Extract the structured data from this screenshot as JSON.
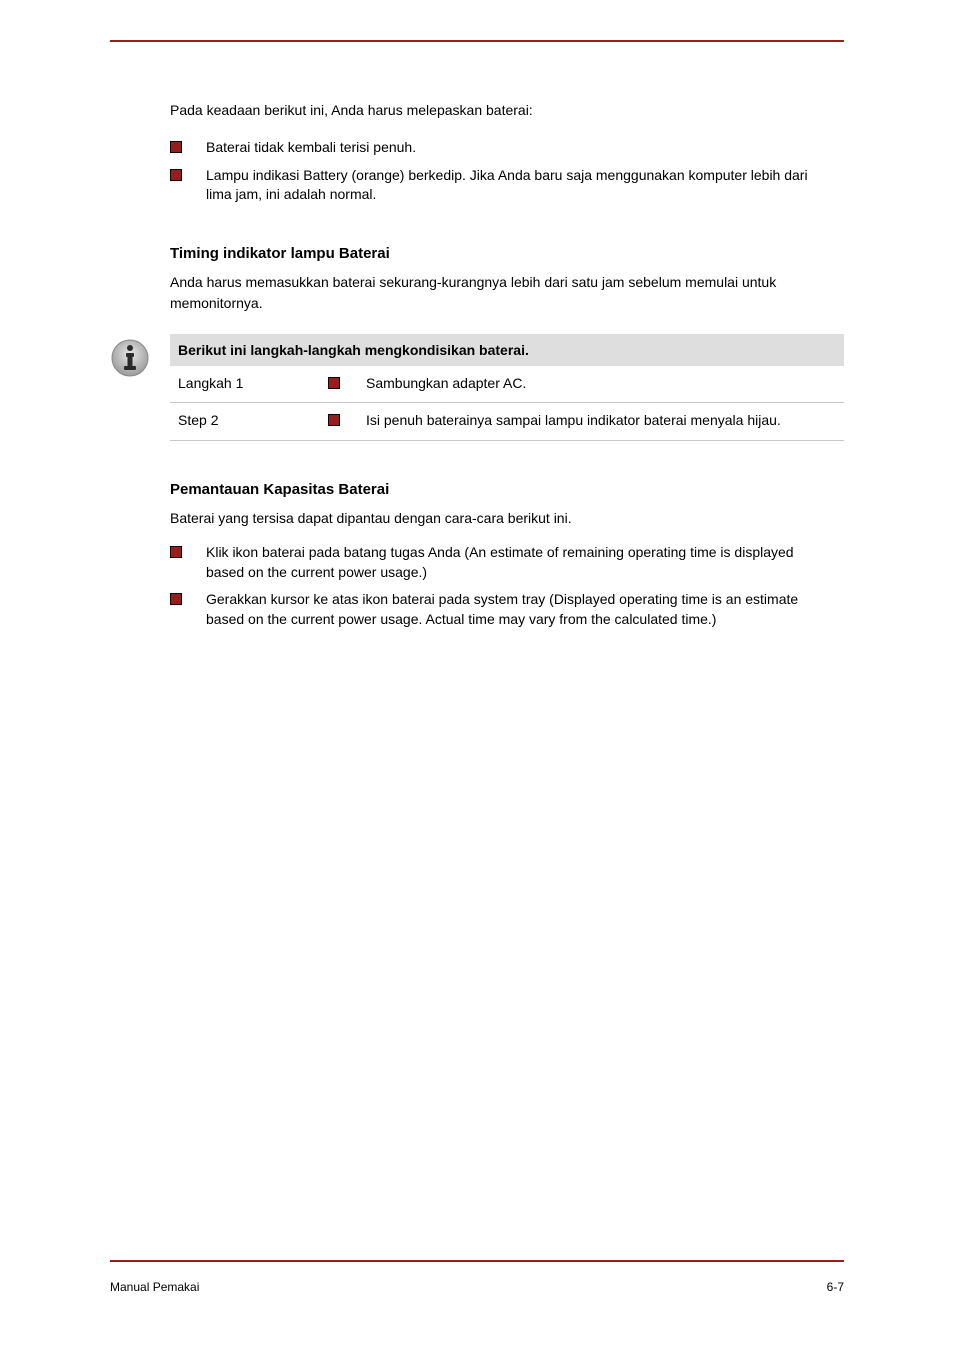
{
  "intro": "Pada keadaan berikut ini, Anda harus melepaskan baterai:",
  "list1": [
    "Baterai tidak kembali terisi penuh.",
    "Lampu indikasi Battery (orange) berkedip. Jika Anda baru saja menggunakan komputer lebih dari lima jam, ini adalah normal."
  ],
  "section1_title": "Timing indikator lampu Baterai",
  "section1_para": "Anda harus memasukkan baterai sekurang-kurangnya lebih dari satu jam sebelum memulai untuk memonitornya.",
  "table_header": "Berikut ini langkah-langkah mengkondisikan baterai.",
  "table": [
    {
      "col1": "Langkah 1",
      "col3": "Sambungkan adapter AC."
    },
    {
      "col1": "Step 2",
      "col3": "Isi penuh baterainya sampai lampu indikator baterai menyala hijau."
    }
  ],
  "section2_title": "Pemantauan Kapasitas Baterai",
  "section2_para": "Baterai yang tersisa dapat dipantau dengan cara-cara berikut ini.",
  "list2": [
    "Klik ikon baterai pada batang tugas Anda (An estimate of remaining operating time is displayed based on the current power usage.)",
    "Gerakkan kursor ke atas ikon baterai pada system tray (Displayed operating time is an estimate based on the current power usage. Actual time may vary from the calculated time.)"
  ],
  "footer_left": "Manual Pemakai",
  "footer_right": "6-7"
}
